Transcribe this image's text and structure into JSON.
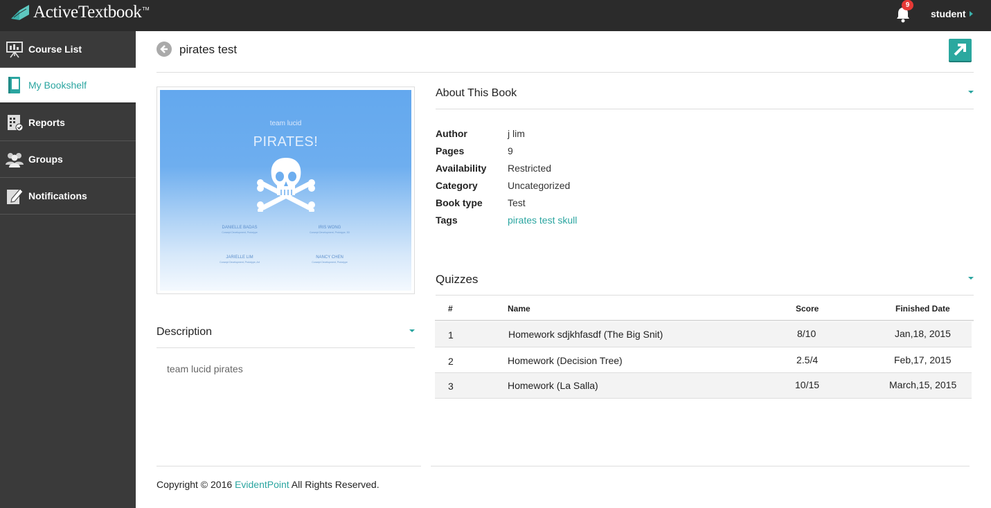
{
  "app": {
    "logo_text": "ActiveTextbook",
    "logo_tm": "TM"
  },
  "header": {
    "notification_count": "9",
    "user_name": "student"
  },
  "sidebar": {
    "items": [
      {
        "label": "Course List",
        "icon": "presentation-board-icon",
        "active": false
      },
      {
        "label": "My Bookshelf",
        "icon": "book-icon",
        "active": true
      },
      {
        "label": "Reports",
        "icon": "report-calendar-icon",
        "active": false
      },
      {
        "label": "Groups",
        "icon": "people-icon",
        "active": false
      },
      {
        "label": "Notifications",
        "icon": "edit-note-icon",
        "active": false
      }
    ]
  },
  "page": {
    "title": "pirates test"
  },
  "cover": {
    "team": "team lucid",
    "title": "PIRATES!",
    "authors": [
      {
        "name": "DANIELLE BADAS",
        "role": "Concept Development, Prototype"
      },
      {
        "name": "IRIS WONG",
        "role": "Concept Development, Prototype, 3D"
      },
      {
        "name": "JARIELLE LIM",
        "role": "Concept Development, Prototype, Art"
      },
      {
        "name": "NANCY CHEN",
        "role": "Concept Development, Prototype"
      }
    ]
  },
  "description": {
    "heading": "Description",
    "text": "team lucid pirates"
  },
  "about": {
    "heading": "About This Book",
    "rows": [
      {
        "label": "Author",
        "value": "j lim"
      },
      {
        "label": "Pages",
        "value": "9"
      },
      {
        "label": "Availability",
        "value": "Restricted"
      },
      {
        "label": "Category",
        "value": "Uncategorized"
      },
      {
        "label": "Book type",
        "value": "Test"
      },
      {
        "label": "Tags",
        "value": "pirates test skull"
      }
    ]
  },
  "quizzes": {
    "heading": "Quizzes",
    "columns": [
      "#",
      "Name",
      "Score",
      "Finished Date"
    ],
    "rows": [
      {
        "num": "1",
        "name": "Homework sdjkhfasdf (The Big Snit)",
        "score": "8/10",
        "date": "Jan,18, 2015"
      },
      {
        "num": "2",
        "name": "Homework (Decision Tree)",
        "score": "2.5/4",
        "date": "Feb,17, 2015"
      },
      {
        "num": "3",
        "name": "Homework (La Salla)",
        "score": "10/15",
        "date": "March,15, 2015"
      }
    ]
  },
  "footer": {
    "prefix": "Copyright © 2016 ",
    "link": "EvidentPoint",
    "suffix": " All Rights Reserved."
  },
  "colors": {
    "accent": "#2aa5a0",
    "topbar": "#2b2b2b",
    "sidebar": "#3a3a3a",
    "badge": "#e53935"
  }
}
